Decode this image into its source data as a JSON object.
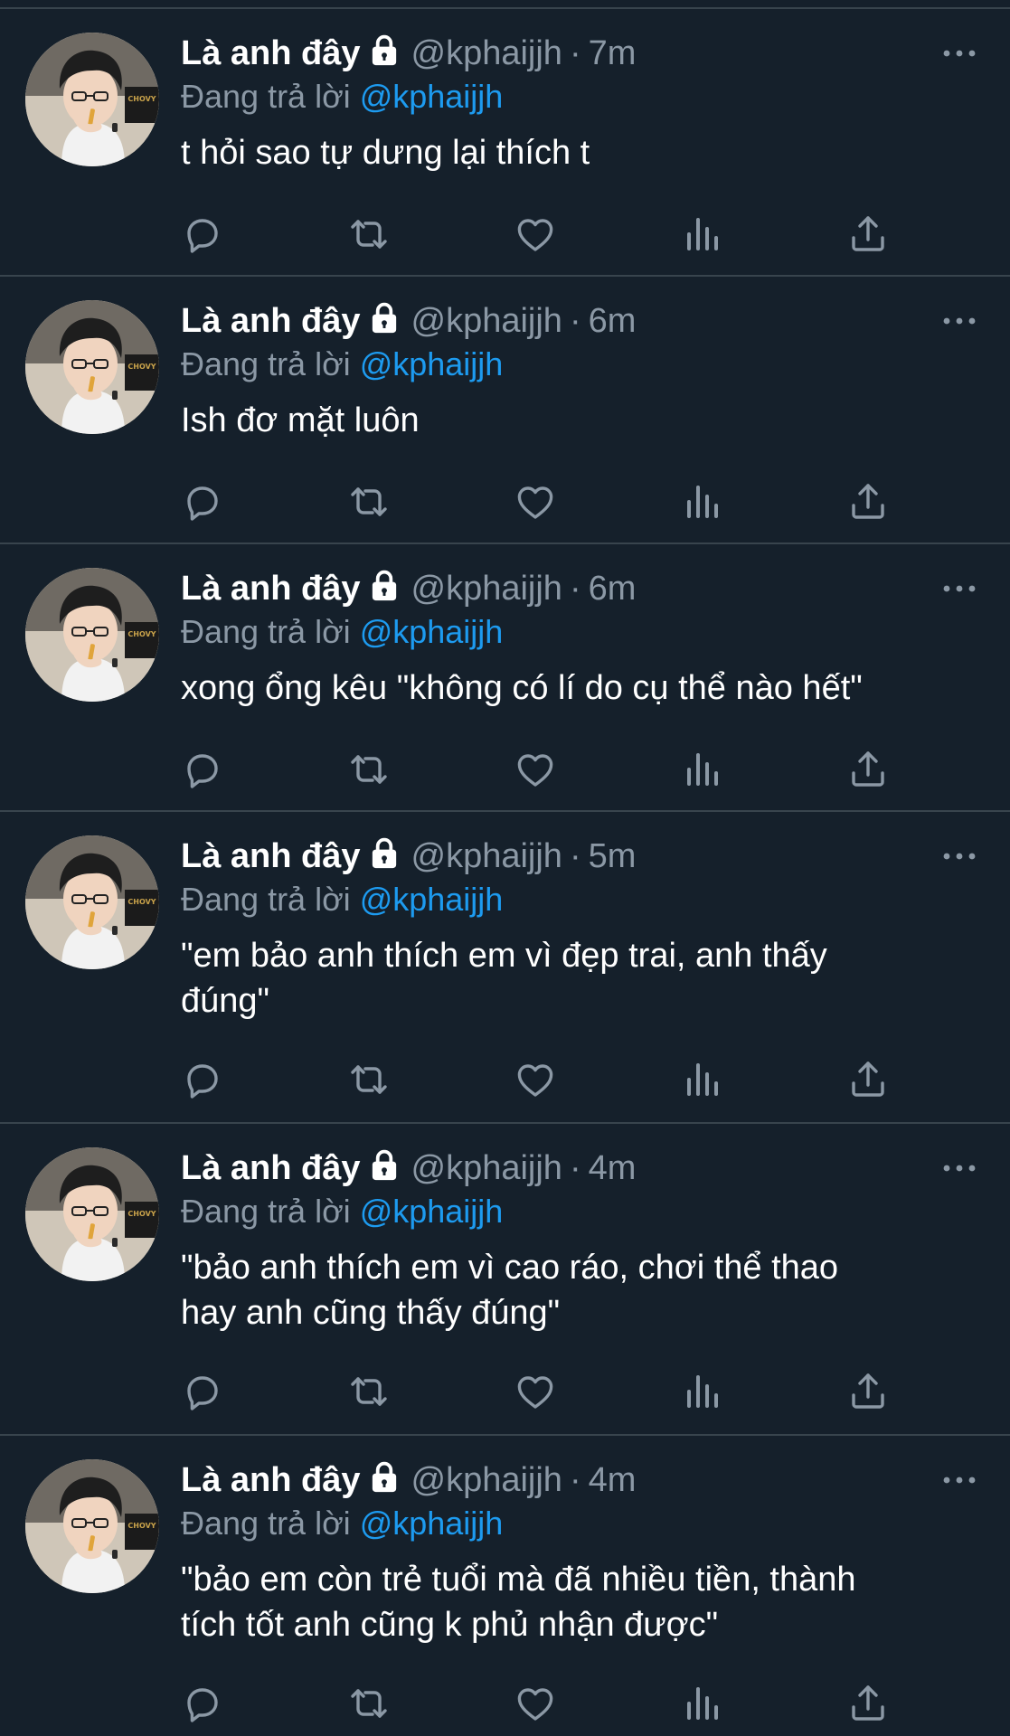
{
  "tweets": [
    {
      "name": "Là anh đây",
      "handle": "@kphaijjh",
      "time": "7m",
      "reply_prefix": "Đang trả lời ",
      "reply_to": "@kphaijjh",
      "text": "t hỏi sao tự dưng lại thích t"
    },
    {
      "name": "Là anh đây",
      "handle": "@kphaijjh",
      "time": "6m",
      "reply_prefix": "Đang trả lời ",
      "reply_to": "@kphaijjh",
      "text": "Ish đơ mặt luôn"
    },
    {
      "name": "Là anh đây",
      "handle": "@kphaijjh",
      "time": "6m",
      "reply_prefix": "Đang trả lời ",
      "reply_to": "@kphaijjh",
      "text": "xong ổng kêu \"không có lí do cụ thể nào hết\""
    },
    {
      "name": "Là anh đây",
      "handle": "@kphaijjh",
      "time": "5m",
      "reply_prefix": "Đang trả lời ",
      "reply_to": "@kphaijjh",
      "text": "\"em bảo anh thích em vì đẹp trai, anh thấy\nđúng\""
    },
    {
      "name": "Là anh đây",
      "handle": "@kphaijjh",
      "time": "4m",
      "reply_prefix": "Đang trả lời ",
      "reply_to": "@kphaijjh",
      "text": "\"bảo anh thích em vì cao ráo, chơi thể thao\nhay anh cũng thấy đúng\""
    },
    {
      "name": "Là anh đây",
      "handle": "@kphaijjh",
      "time": "4m",
      "reply_prefix": "Đang trả lời ",
      "reply_to": "@kphaijjh",
      "text": "\"bảo em còn trẻ tuổi mà đã nhiều tiền, thành\ntích tốt anh cũng k phủ nhận được\""
    }
  ],
  "avatar_badge_text": "CHOVY",
  "separator": "·",
  "icons": {
    "lock": "lock-icon",
    "more": "more-icon",
    "reply": "reply-icon",
    "retweet": "retweet-icon",
    "like": "heart-icon",
    "views": "views-icon",
    "share": "share-icon"
  },
  "colors": {
    "background": "#15202b",
    "divider": "#38444d",
    "text": "#ffffff",
    "muted": "#8b98a5",
    "link": "#1d9bf0"
  }
}
